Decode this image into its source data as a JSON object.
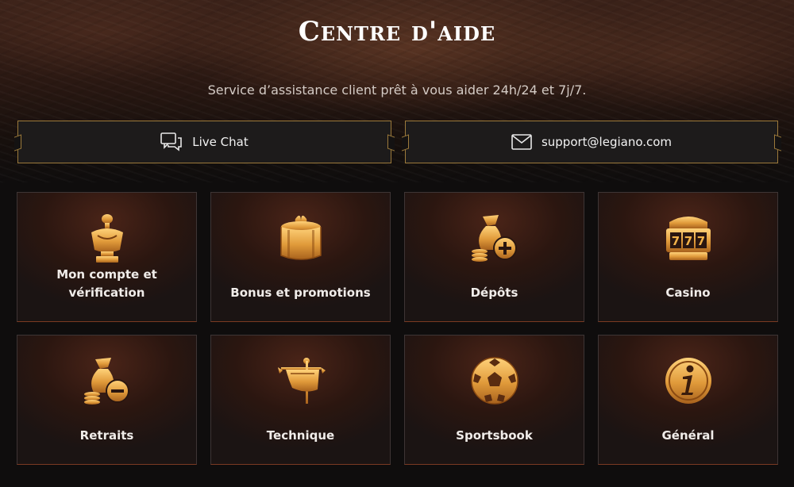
{
  "header": {
    "title": "Centre d'aide",
    "subtitle": "Service d’assistance client prêt à vous aider 24h/24 et 7j/7."
  },
  "contact": {
    "chat_label": "Live Chat",
    "chat_icon": "chat-bubbles-icon",
    "email_label": "support@legiano.com",
    "email_icon": "envelope-icon"
  },
  "categories": [
    {
      "label": "Mon compte et vérification",
      "icon": "bust-statue-icon"
    },
    {
      "label": "Bonus et promotions",
      "icon": "gift-box-icon"
    },
    {
      "label": "Dépôts",
      "icon": "money-bag-plus-icon"
    },
    {
      "label": "Casino",
      "icon": "slot-machine-icon"
    },
    {
      "label": "Retraits",
      "icon": "money-bag-minus-icon"
    },
    {
      "label": "Technique",
      "icon": "war-banner-icon"
    },
    {
      "label": "Sportsbook",
      "icon": "soccer-ball-icon"
    },
    {
      "label": "Général",
      "icon": "info-icon"
    }
  ],
  "colors": {
    "gold": "#e0a444",
    "border_gold": "#9c7a3b",
    "background": "#0f0d0d"
  }
}
